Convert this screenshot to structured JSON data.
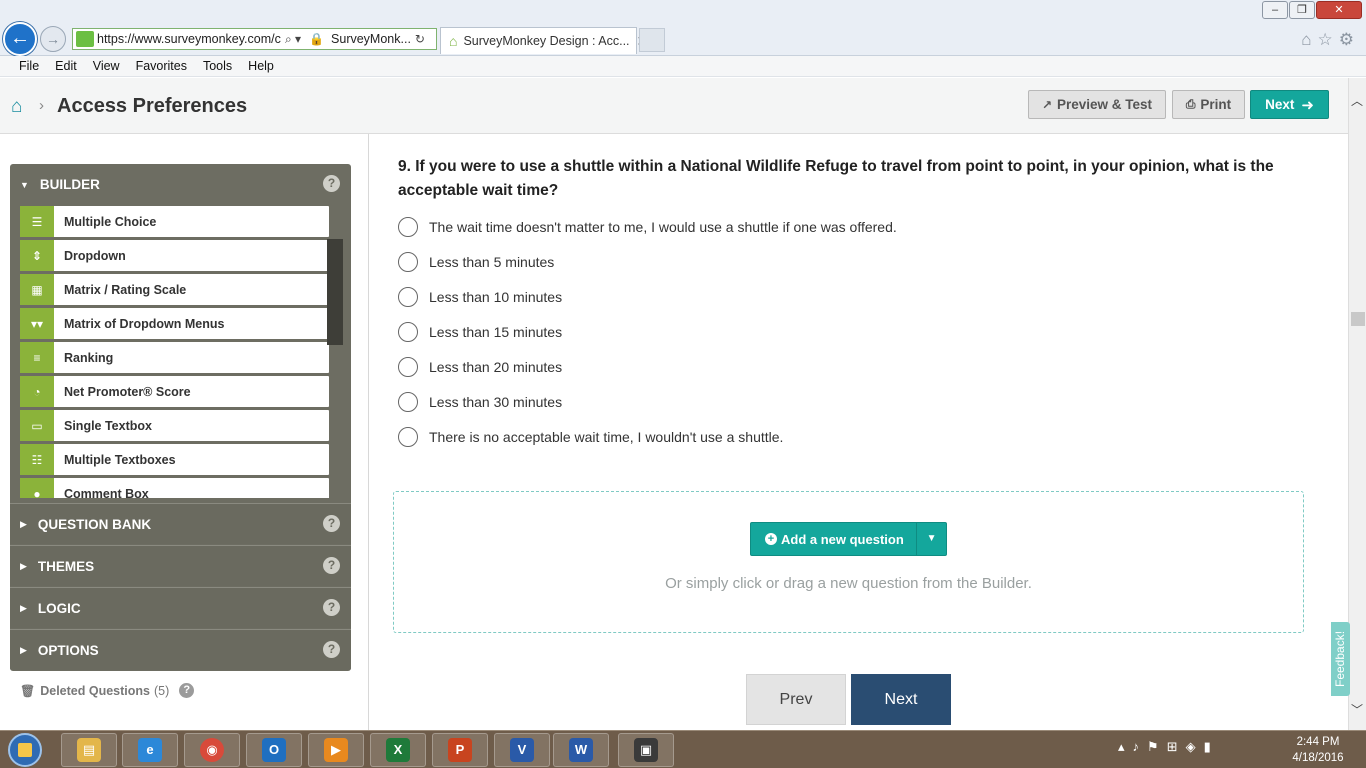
{
  "browser": {
    "url": "https://www.surveymonkey.com/c",
    "site_identity": "SurveyMonk...",
    "tab_title": "SurveyMonkey Design : Acc...",
    "menu": [
      "File",
      "Edit",
      "View",
      "Favorites",
      "Tools",
      "Help"
    ]
  },
  "header": {
    "page_title": "Access Preferences",
    "preview_label": "Preview & Test",
    "print_label": "Print",
    "next_label": "Next"
  },
  "builder": {
    "title": "BUILDER",
    "help": "?",
    "items": [
      {
        "label": "Multiple Choice",
        "icon": "list-icon"
      },
      {
        "label": "Dropdown",
        "icon": "dropdown-icon"
      },
      {
        "label": "Matrix / Rating Scale",
        "icon": "grid-icon"
      },
      {
        "label": "Matrix of Dropdown Menus",
        "icon": "matrix-dropdown-icon"
      },
      {
        "label": "Ranking",
        "icon": "ranking-icon"
      },
      {
        "label": "Net Promoter® Score",
        "icon": "gauge-icon"
      },
      {
        "label": "Single Textbox",
        "icon": "textbox-icon"
      },
      {
        "label": "Multiple Textboxes",
        "icon": "textboxes-icon"
      },
      {
        "label": "Comment Box",
        "icon": "comment-icon"
      }
    ],
    "sections": [
      {
        "label": "QUESTION BANK"
      },
      {
        "label": "THEMES"
      },
      {
        "label": "LOGIC"
      },
      {
        "label": "OPTIONS"
      }
    ],
    "deleted_label": "Deleted Questions",
    "deleted_count": "(5)"
  },
  "question": {
    "title": "9. If you were to use a shuttle within a National Wildlife Refuge to travel from point to point, in your opinion, what is the acceptable wait time?",
    "options": [
      "The wait time doesn't matter to me, I would use a shuttle if one was offered.",
      "Less than 5 minutes",
      "Less than 10 minutes",
      "Less than 15 minutes",
      "Less than 20 minutes",
      "Less than 30 minutes",
      "There is no acceptable wait time, I wouldn't use a shuttle."
    ]
  },
  "add_question": {
    "button_label": "Add a new question",
    "hint": "Or simply click or drag a new question from the Builder."
  },
  "pager": {
    "prev": "Prev",
    "next": "Next"
  },
  "feedback": "Feedback!",
  "taskbar": {
    "time": "2:44 PM",
    "date": "4/18/2016",
    "apps": [
      {
        "name": "explorer",
        "glyph": "▤",
        "color": "#e3b64a"
      },
      {
        "name": "internet-explorer",
        "glyph": "e",
        "color": "#2c88d8"
      },
      {
        "name": "chrome",
        "glyph": "◉",
        "color": "#d84a3a"
      },
      {
        "name": "outlook",
        "glyph": "O",
        "color": "#1f6fc0"
      },
      {
        "name": "media",
        "glyph": "▶",
        "color": "#e8891f"
      },
      {
        "name": "excel",
        "glyph": "X",
        "color": "#1f7a3a"
      },
      {
        "name": "powerpoint",
        "glyph": "P",
        "color": "#c8441f"
      },
      {
        "name": "visio",
        "glyph": "V",
        "color": "#2a5aa8"
      },
      {
        "name": "word",
        "glyph": "W",
        "color": "#2a5aa8"
      },
      {
        "name": "terminal",
        "glyph": "▣",
        "color": "#3a3a3a"
      }
    ]
  }
}
